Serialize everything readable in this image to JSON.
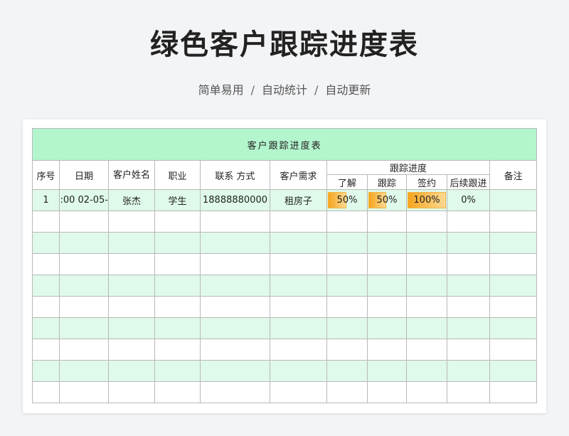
{
  "header": {
    "title": "绿色客户跟踪进度表",
    "subtitle_items": [
      "简单易用",
      "自动统计",
      "自动更新"
    ],
    "separator": "/"
  },
  "sheet": {
    "title": "客户跟踪进度表",
    "columns": {
      "seq": "序号",
      "date": "日期",
      "name": "客户姓名",
      "job": "职业",
      "contact": "联系 方式",
      "demand": "客户需求",
      "progress_group": "跟踪进度",
      "progress_sub": [
        "了解",
        "跟踪",
        "签约",
        "后续跟进"
      ],
      "remark": "备注"
    },
    "rows": [
      {
        "seq": "1",
        "date": "-02-05 00:",
        "name": "张杰",
        "job": "学生",
        "contact": "18888880000",
        "demand": "租房子",
        "progress": [
          {
            "label": "50%",
            "value": 0.5
          },
          {
            "label": "50%",
            "value": 0.5
          },
          {
            "label": "100%",
            "value": 1.0
          },
          {
            "label": "0%",
            "value": 0
          }
        ],
        "remark": ""
      }
    ],
    "empty_rows": 9,
    "colors": {
      "title_bg": "#b3f5cd",
      "stripe": "#dff9ea",
      "bar": "#f6a51e"
    }
  }
}
